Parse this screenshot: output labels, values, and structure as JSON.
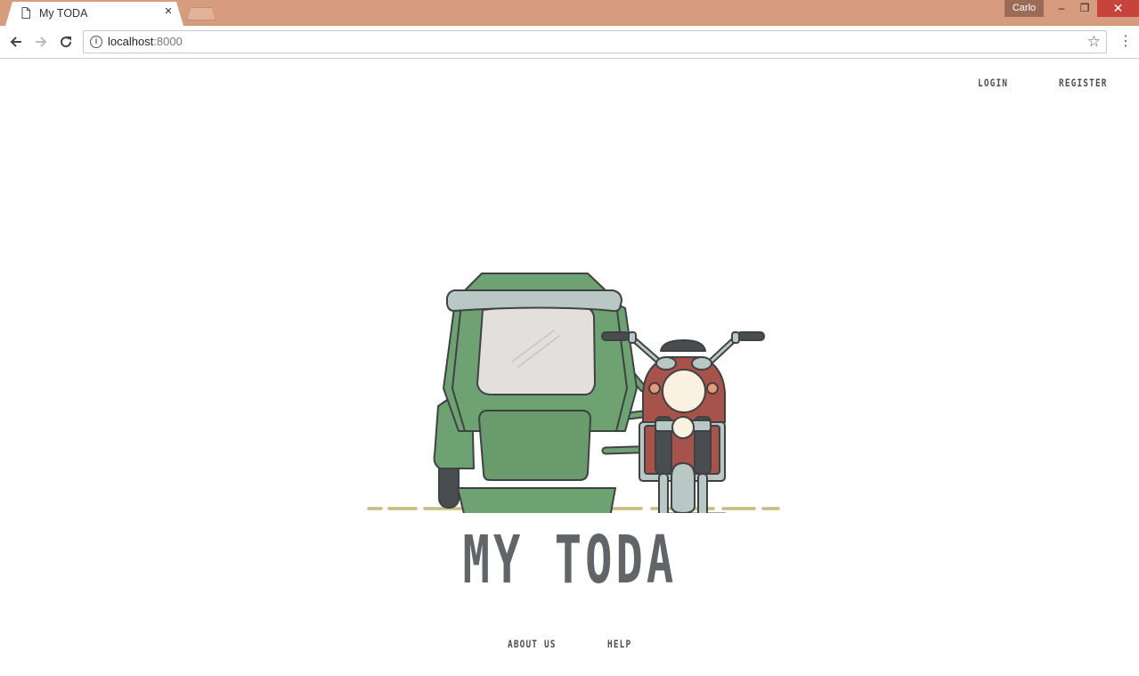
{
  "browser": {
    "tab_title": "My TODA",
    "tab_close": "×",
    "profile_name": "Carlo",
    "window_controls": {
      "minimize": "‒",
      "maximize": "❐",
      "close": "✕"
    },
    "address": {
      "host": "localhost",
      "port": ":8000"
    },
    "icons": {
      "back": "back-arrow-icon",
      "forward": "forward-arrow-icon",
      "reload": "reload-icon",
      "info": "info-icon",
      "star": "star-icon",
      "menu": "kebab-menu-icon"
    }
  },
  "header_nav": {
    "login": "LOGIN",
    "register": "REGISTER"
  },
  "hero": {
    "brand_title": "MY TODA",
    "illustration": "tricycle-illustration",
    "colors": {
      "sidecar_green": "#6fa272",
      "roof_grey": "#b9c8c4",
      "window": "#e3dfdc",
      "bike_red": "#a7524b",
      "road_line": "#c9bb7a",
      "outline": "#3f4244",
      "title": "#616567"
    }
  },
  "footer_nav": {
    "about": "ABOUT US",
    "help": "HELP"
  }
}
